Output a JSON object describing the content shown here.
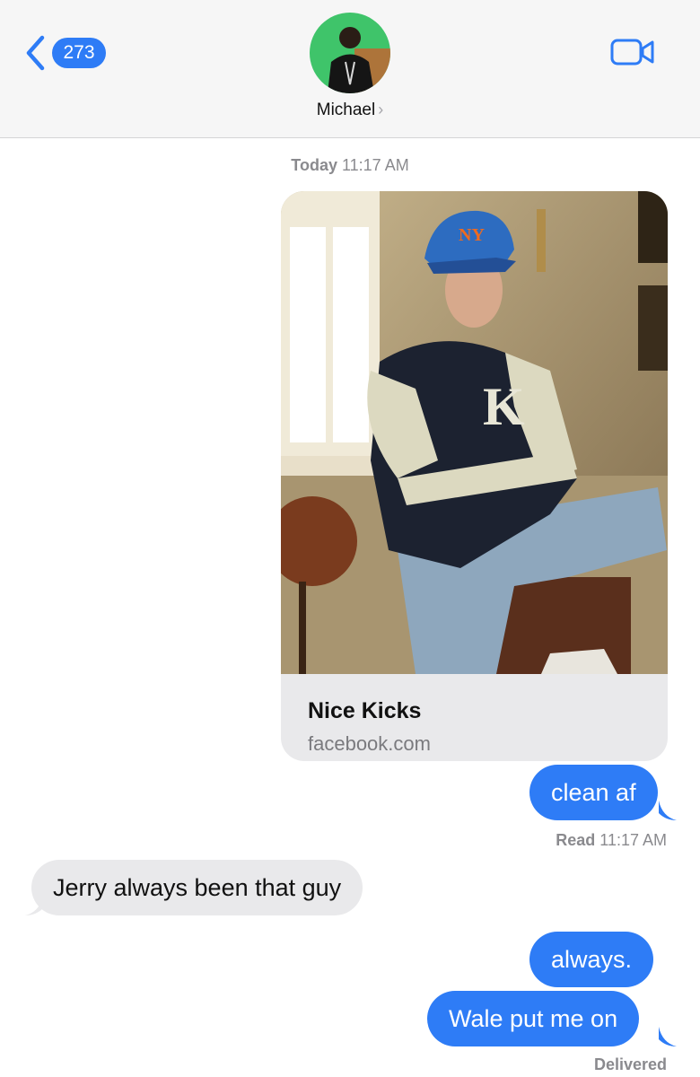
{
  "header": {
    "back_count": "273",
    "contact_name": "Michael",
    "contact_chevron": "›",
    "icons": {
      "back": "chevron-left-icon",
      "video": "video-camera-icon"
    },
    "accent_color": "#2e7cf6"
  },
  "conversation": {
    "timestamp_day": "Today",
    "timestamp_time": "11:17 AM",
    "link_preview": {
      "title": "Nice Kicks",
      "domain": "facebook.com"
    },
    "messages": [
      {
        "direction": "outgoing",
        "text": "clean af"
      },
      {
        "direction": "incoming",
        "text": "Jerry always been that guy"
      },
      {
        "direction": "outgoing",
        "text": "always."
      },
      {
        "direction": "outgoing",
        "text": "Wale put me on"
      }
    ],
    "read_receipt_label": "Read",
    "read_receipt_time": "11:17 AM",
    "delivered_label": "Delivered"
  },
  "colors": {
    "outgoing_bubble": "#2e7cf6",
    "incoming_bubble": "#e9e9eb",
    "header_bg": "#f6f6f6"
  }
}
